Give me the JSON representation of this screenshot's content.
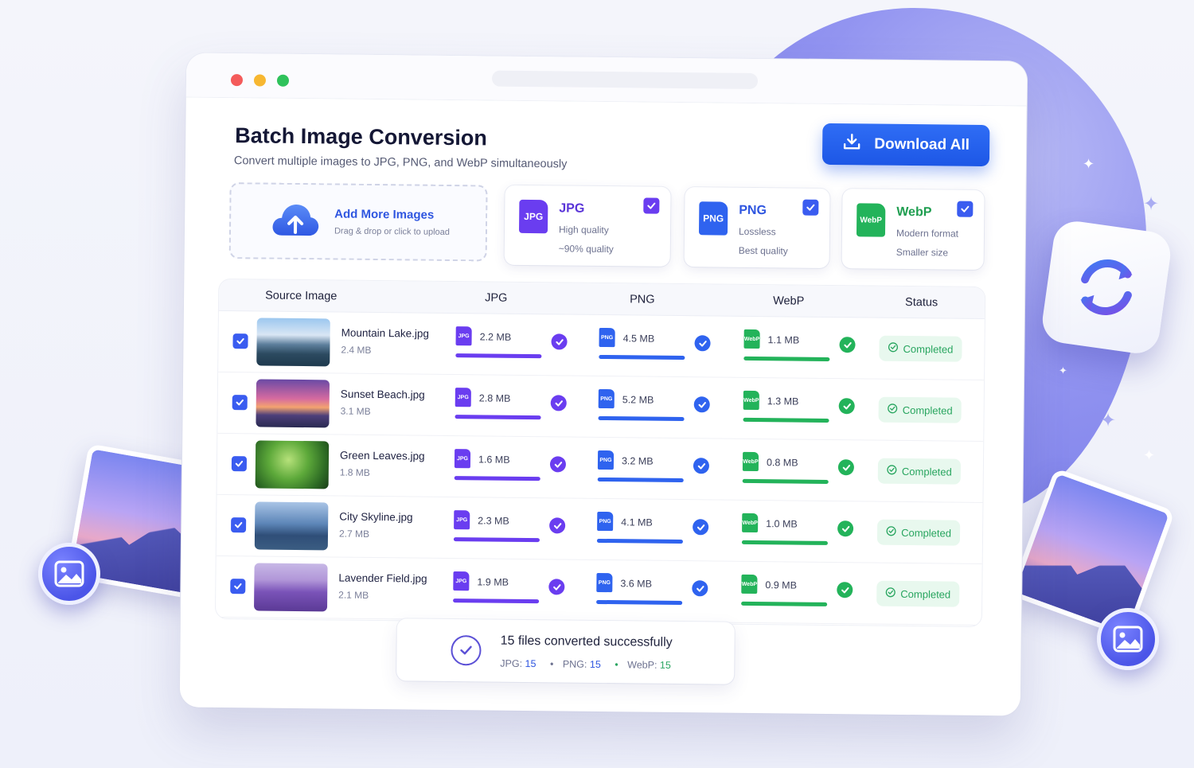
{
  "app": {
    "title": "Batch Image Conversion",
    "subtitle": "Convert multiple images to JPG, PNG, and WebP simultaneously",
    "download_label": "Download All"
  },
  "upload": {
    "title": "Add More Images",
    "hint": "Drag & drop or click to upload"
  },
  "formats": [
    {
      "badge": "JPG",
      "name": "JPG",
      "line1": "High quality",
      "line2": "~90% quality",
      "color": "#6a3df0"
    },
    {
      "badge": "PNG",
      "name": "PNG",
      "line1": "Lossless",
      "line2": "Best quality",
      "color": "#2f63ef"
    },
    {
      "badge": "WebP",
      "name": "WebP",
      "line1": "Modern format",
      "line2": "Smaller size",
      "color": "#23b35a"
    }
  ],
  "table": {
    "headers": {
      "source": "Source Image",
      "jpg": "JPG",
      "png": "PNG",
      "webp": "WebP",
      "status": "Status"
    },
    "badges": {
      "jpg": "JPG",
      "png": "PNG",
      "webp": "WebP"
    },
    "rows": [
      {
        "name": "Mountain Lake.jpg",
        "size": "2.4 MB",
        "jpg": "2.2 MB",
        "png": "4.5 MB",
        "webp": "1.1 MB",
        "status": "Completed"
      },
      {
        "name": "Sunset Beach.jpg",
        "size": "3.1 MB",
        "jpg": "2.8 MB",
        "png": "5.2 MB",
        "webp": "1.3 MB",
        "status": "Completed"
      },
      {
        "name": "Green Leaves.jpg",
        "size": "1.8 MB",
        "jpg": "1.6 MB",
        "png": "3.2 MB",
        "webp": "0.8 MB",
        "status": "Completed"
      },
      {
        "name": "City Skyline.jpg",
        "size": "2.7 MB",
        "jpg": "2.3 MB",
        "png": "4.1 MB",
        "webp": "1.0 MB",
        "status": "Completed"
      },
      {
        "name": "Lavender Field.jpg",
        "size": "2.1 MB",
        "jpg": "1.9 MB",
        "png": "3.6 MB",
        "webp": "0.9 MB",
        "status": "Completed"
      }
    ],
    "progress_complete": 1.0
  },
  "summary": {
    "title": "15 files converted successfully",
    "jpg_label": "JPG:",
    "jpg_count": "15",
    "png_label": "PNG:",
    "png_count": "15",
    "webp_label": "WebP:",
    "webp_count": "15",
    "bullet": "•"
  },
  "colors": {
    "accent": "#2f56e0",
    "jpg": "#6a3df0",
    "png": "#2f63ef",
    "webp": "#23b35a",
    "success": "#28a55f"
  }
}
